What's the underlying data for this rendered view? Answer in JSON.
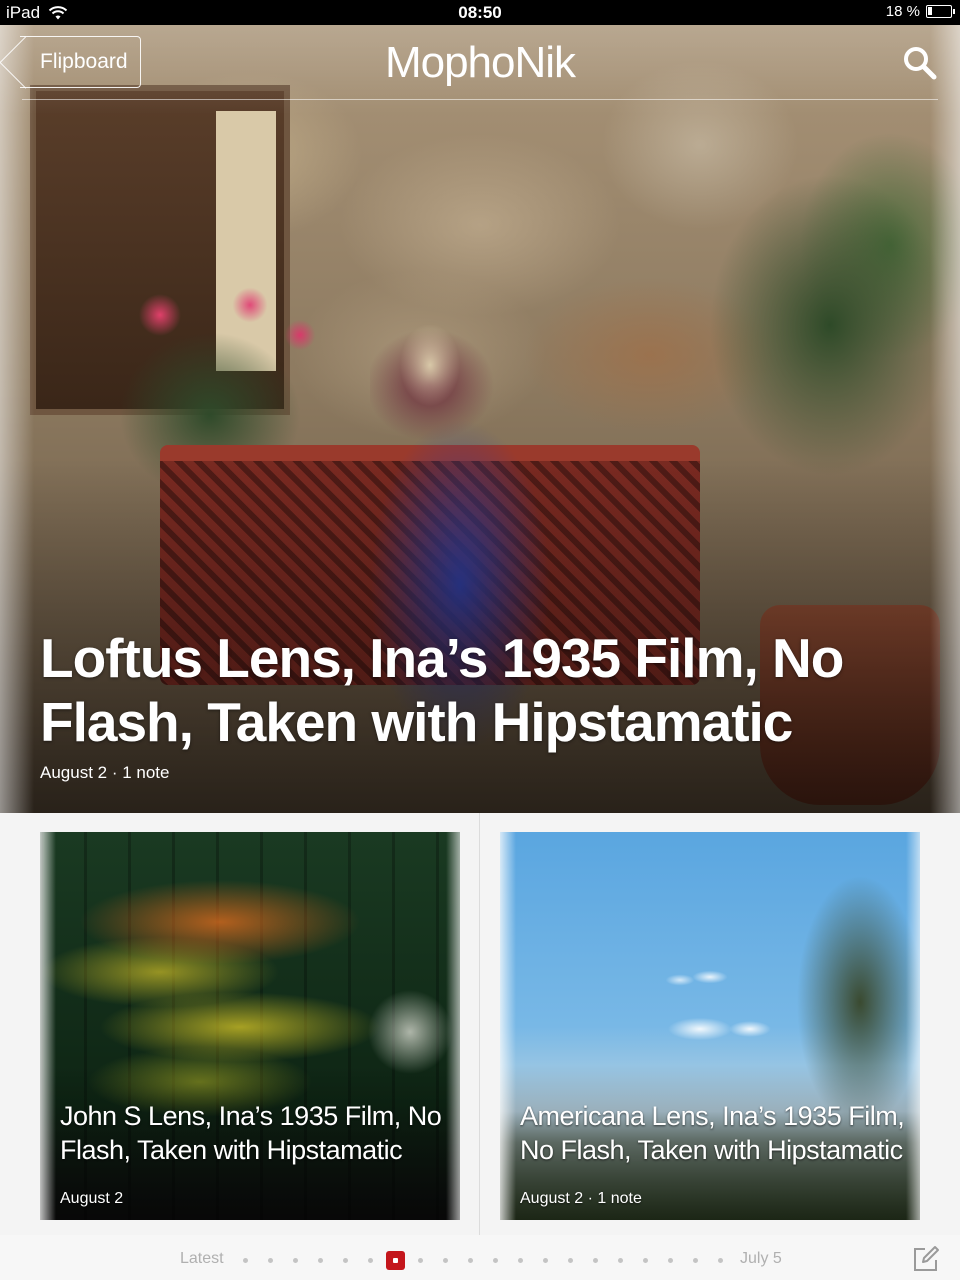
{
  "status_bar": {
    "device": "iPad",
    "time": "08:50",
    "battery": "18 %",
    "battery_level": 0.18,
    "icons": [
      "wifi-icon",
      "battery-icon"
    ]
  },
  "nav": {
    "back_label": "Flipboard",
    "title": "MophoNik",
    "search_icon": "search-icon"
  },
  "hero": {
    "title": "Loftus Lens, Ina’s 1935 Film, No Flash, Taken with Hipstamatic",
    "meta": "August 2 · 1 note"
  },
  "cards": [
    {
      "title": "John S Lens, Ina’s 1935 Film, No Flash, Taken with Hipstamatic",
      "meta": "August 2"
    },
    {
      "title": "Americana Lens, Ina’s 1935 Film, No Flash, Taken with Hipstamatic",
      "meta": "August 2 · 1 note"
    }
  ],
  "pager": {
    "start_label": "Latest",
    "end_label": "July 5",
    "dot_count": 20,
    "current_index": 6,
    "accent": "#c4161c",
    "compose_icon": "compose-icon"
  }
}
